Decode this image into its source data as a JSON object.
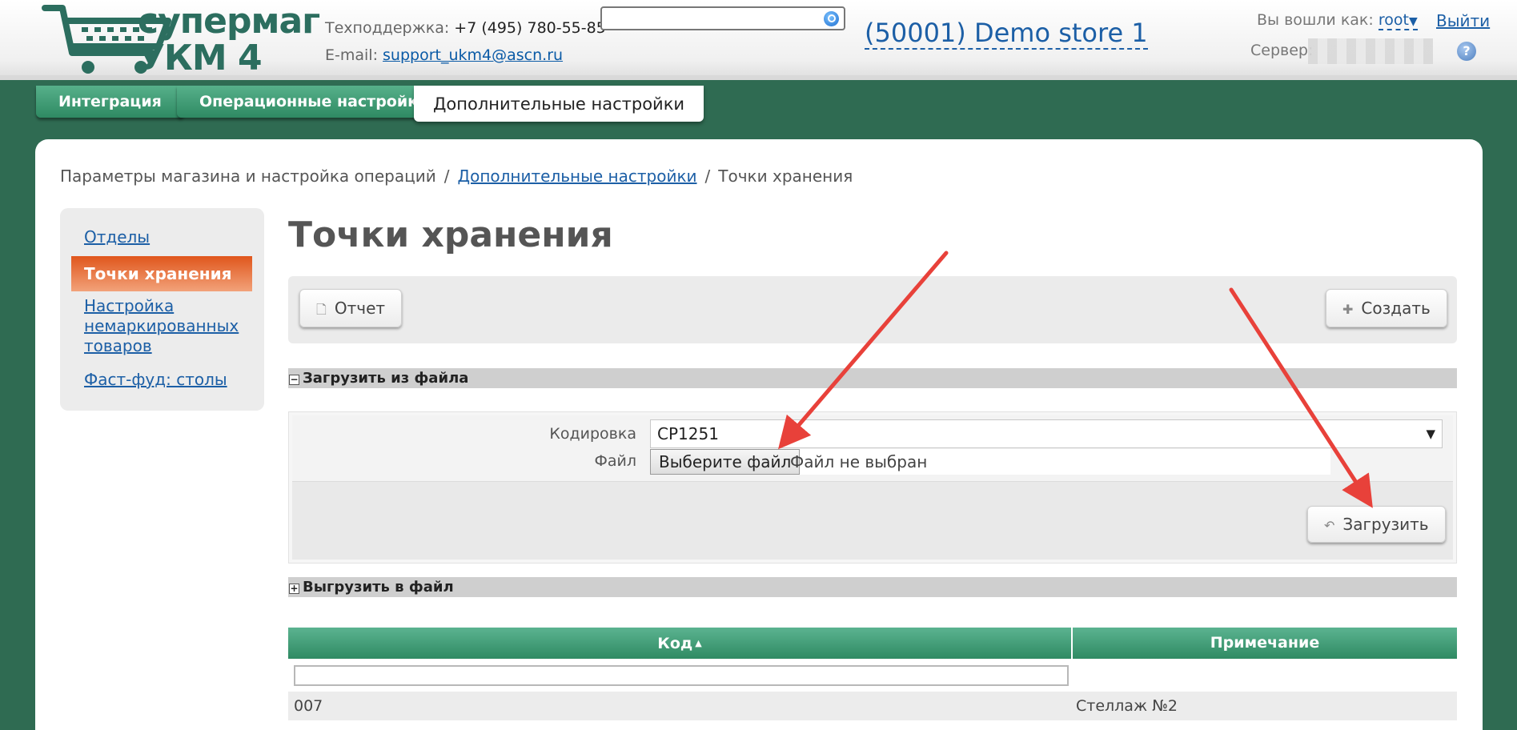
{
  "header": {
    "logo_line1": "супермаг",
    "logo_line2": "УКМ 4",
    "support_label": "Техподдержка:",
    "support_phone": "+7 (495) 780-55-85",
    "email_label": "E-mail:",
    "email": "support_ukm4@ascn.ru",
    "search_value": "",
    "store": "(50001) Demo store 1",
    "logged_in_label": "Вы вошли как:",
    "username": "root",
    "logout": "Выйти",
    "server_label": "Сервер:",
    "help_icon": "question-icon"
  },
  "tabs": [
    {
      "label": "Интеграция"
    },
    {
      "label": "Операционные настройки"
    },
    {
      "label": "Дополнительные настройки"
    }
  ],
  "breadcrumbs": {
    "item1": "Параметры магазина и настройка операций",
    "item2": "Дополнительные настройки",
    "item3": "Точки хранения",
    "separator": "/"
  },
  "sidebar": {
    "items": [
      {
        "label": "Отделы"
      },
      {
        "label": "Точки хранения"
      },
      {
        "label": "Настройка немаркированных товаров"
      },
      {
        "label": "Фаст-фуд: столы"
      }
    ]
  },
  "page_title": "Точки хранения",
  "toolbar": {
    "report_label": "Отчет",
    "create_label": "Создать"
  },
  "upload_section": {
    "title": "Загрузить из файла",
    "toggle": "−",
    "encoding_label": "Кодировка",
    "encoding_value": "CP1251",
    "file_label": "Файл",
    "file_button": "Выберите файл",
    "file_status": "Файл не выбран",
    "upload_button": "Загрузить"
  },
  "download_section": {
    "title": "Выгрузить в файл",
    "toggle": "+"
  },
  "table": {
    "columns": [
      "Код",
      "Примечание"
    ],
    "sort_indicator": "▲",
    "rows": [
      {
        "code": "007",
        "note": "Стеллаж №2"
      }
    ]
  },
  "colors": {
    "background": "#2f6b52",
    "tab_green": "#3d9a72",
    "active_sidebar": "#e8642c",
    "link": "#1c5fa6",
    "annotation_arrow": "#e8413a"
  }
}
